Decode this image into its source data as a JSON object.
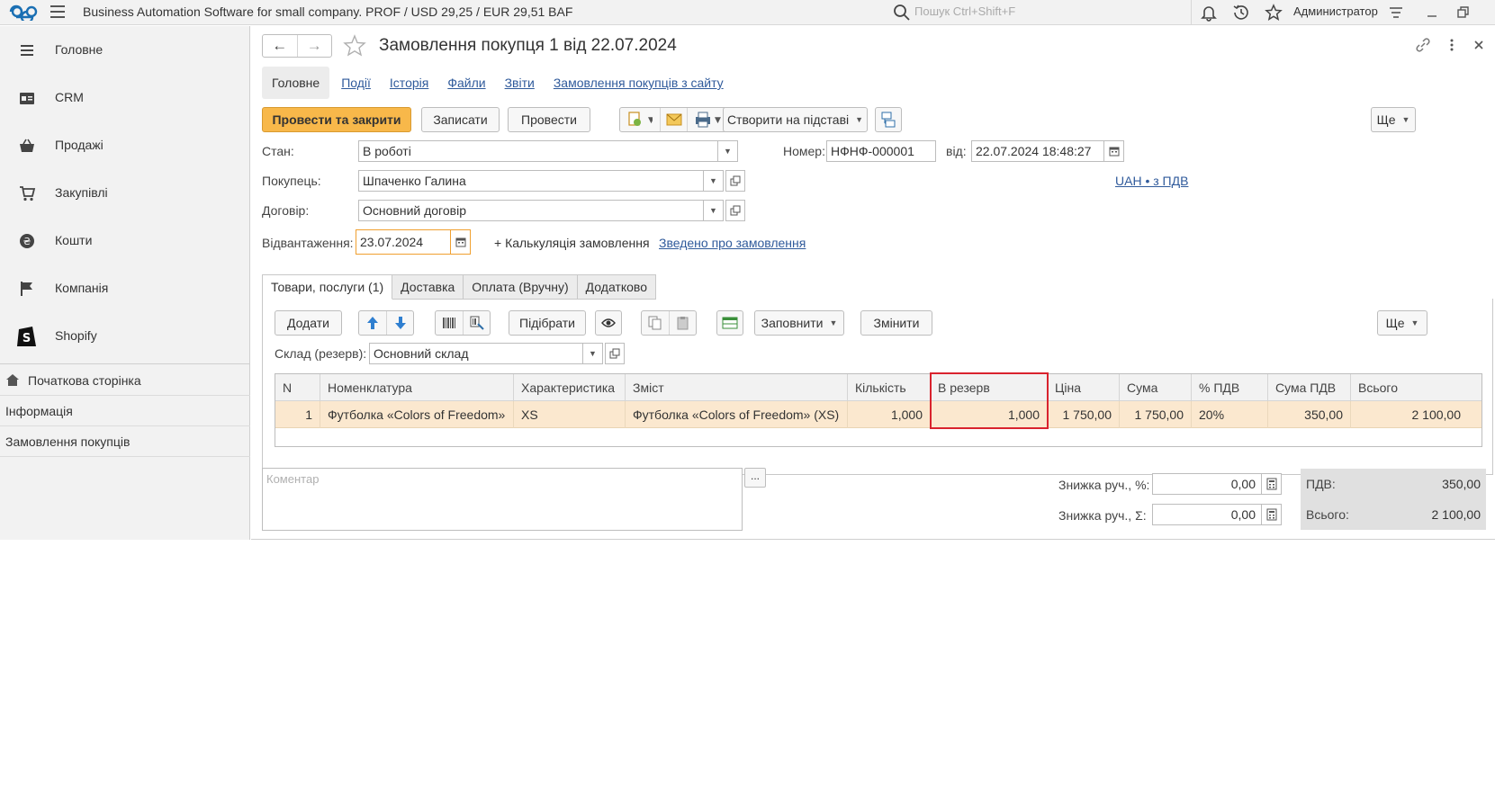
{
  "topbar": {
    "app_title": "Business Automation Software for small company. PROF / USD 29,25 / EUR 29,51 BAF",
    "search_placeholder": "Пошук Ctrl+Shift+F",
    "user": "Администратор"
  },
  "sidebar": {
    "sections": [
      {
        "label": "Головне",
        "icon": "menu-icon"
      },
      {
        "label": "CRM",
        "icon": "crm-icon"
      },
      {
        "label": "Продажі",
        "icon": "basket-icon"
      },
      {
        "label": "Закупівлі",
        "icon": "cart-icon"
      },
      {
        "label": "Кошти",
        "icon": "money-icon"
      },
      {
        "label": "Компанія",
        "icon": "flag-icon"
      },
      {
        "label": "Shopify",
        "icon": "shopify-icon"
      }
    ],
    "open_windows": [
      {
        "label": "Початкова сторінка"
      },
      {
        "label": "Інформація"
      },
      {
        "label": "Замовлення покупців"
      }
    ]
  },
  "form": {
    "title": "Замовлення покупця 1 від 22.07.2024",
    "tabs": [
      "Головне",
      "Події",
      "Історія",
      "Файли",
      "Звіти",
      "Замовлення покупців з сайту"
    ],
    "toolbar": {
      "post_close": "Провести та закрити",
      "save": "Записати",
      "post": "Провести",
      "create_based": "Створити на підставі",
      "more": "Ще"
    },
    "fields": {
      "state_label": "Стан:",
      "state_value": "В роботі",
      "number_label": "Номер:",
      "number_value": "НФНФ-000001",
      "date_label": "від:",
      "date_value": "22.07.2024 18:48:27",
      "buyer_label": "Покупець:",
      "buyer_value": "Шпаченко Галина",
      "currency_link": "UAH • з ПДВ",
      "contract_label": "Договір:",
      "contract_value": "Основний договір",
      "shipment_label": "Відвантаження:",
      "shipment_value": "23.07.2024",
      "calc_link": "+ Калькуляція замовлення",
      "summary_link": "Зведено про замовлення"
    },
    "subtabs": [
      "Товари, послуги (1)",
      "Доставка",
      "Оплата (Вручну)",
      "Додатково"
    ],
    "goods_toolbar": {
      "add": "Додати",
      "pick": "Підібрати",
      "fill": "Заповнити",
      "change": "Змінити",
      "more": "Ще"
    },
    "warehouse_label": "Склад (резерв):",
    "warehouse_value": "Основний склад",
    "table": {
      "columns": [
        "N",
        "Номенклатура",
        "Характеристика",
        "Зміст",
        "Кількість",
        "В резерв",
        "Ціна",
        "Сума",
        "% ПДВ",
        "Сума ПДВ",
        "Всього"
      ],
      "rows": [
        [
          "1",
          "Футболка «Colors of Freedom»",
          "XS",
          "Футболка «Colors of Freedom»  (XS)",
          "1,000",
          "1,000",
          "1 750,00",
          "1 750,00",
          "20%",
          "350,00",
          "2 100,00"
        ]
      ]
    },
    "comment_placeholder": "Коментар",
    "discount_pct_label": "Знижка руч., %:",
    "discount_pct_value": "0,00",
    "discount_sum_label": "Знижка руч., Σ:",
    "discount_sum_value": "0,00",
    "vat_label": "ПДВ:",
    "vat_value": "350,00",
    "total_label": "Всього:",
    "total_value": "2 100,00"
  }
}
